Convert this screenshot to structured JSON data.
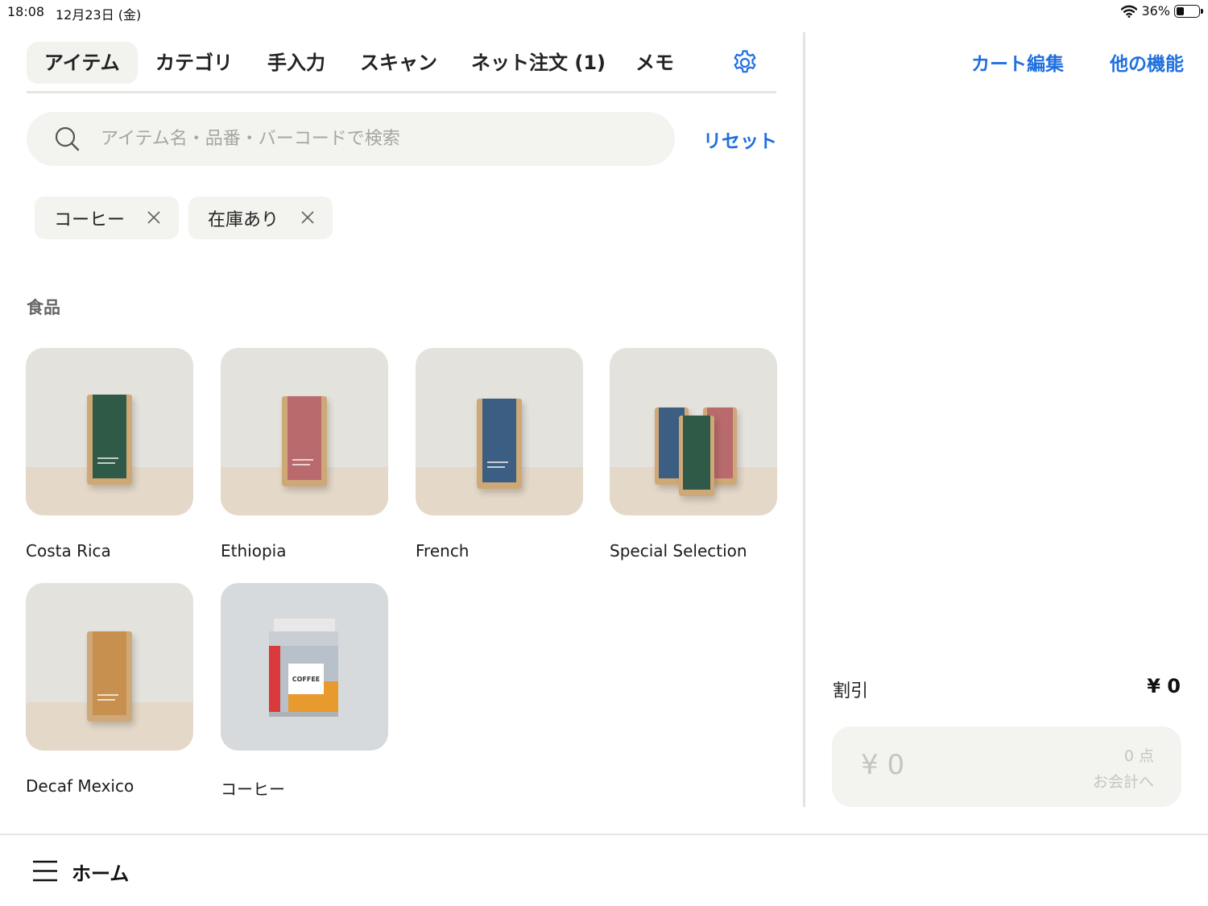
{
  "status_bar": {
    "time": "18:08",
    "date": "12月23日 (金)",
    "battery": "36%",
    "battery_level": 0.36
  },
  "tabs": [
    {
      "label": "アイテム",
      "active": true
    },
    {
      "label": "カテゴリ",
      "active": false
    },
    {
      "label": "手入力",
      "active": false
    },
    {
      "label": "スキャン",
      "active": false
    },
    {
      "label": "ネット注文 (1)",
      "active": false
    },
    {
      "label": "メモ",
      "active": false
    }
  ],
  "search": {
    "placeholder": "アイテム名・品番・バーコードで検索",
    "value": "",
    "reset_label": "リセット"
  },
  "filters": [
    {
      "label": "コーヒー"
    },
    {
      "label": "在庫あり"
    }
  ],
  "section": {
    "title": "食品"
  },
  "items": [
    {
      "name": "Costa Rica",
      "bag_colors": [
        "#2f5a47"
      ]
    },
    {
      "name": "Ethiopia",
      "bag_colors": [
        "#b96a6d"
      ]
    },
    {
      "name": "French",
      "bag_colors": [
        "#3c5e83"
      ]
    },
    {
      "name": "Special Selection",
      "bag_colors": [
        "#3c5e83",
        "#2f5a47",
        "#b96a6d"
      ]
    },
    {
      "name": "Decaf Mexico",
      "bag_colors": [
        "#c7904e"
      ]
    },
    {
      "name": "コーヒー",
      "package_text": "COFFEE"
    }
  ],
  "cart": {
    "edit_label": "カート編集",
    "more_label": "他の機能",
    "discount_label": "割引",
    "discount_value": "¥ 0",
    "total": "¥ 0",
    "count": "0 点",
    "checkout_label": "お会計へ"
  },
  "bottom_nav": {
    "home_label": "ホーム"
  },
  "colors": {
    "accent": "#1f6fe0",
    "chip_bg": "#f3f3ef",
    "divider": "#e4e4e0"
  }
}
